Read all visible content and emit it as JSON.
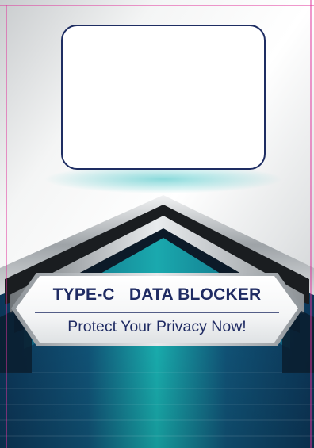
{
  "label": {
    "title": "TYPE-C   DATA BLOCKER",
    "tagline": "Protect Your Privacy Now!"
  },
  "colors": {
    "navy_text": "#1f2b63",
    "window_border": "#1e2d62",
    "teal": "#18a3ad",
    "deep_blue": "#0e3f66",
    "trim_pink": "#e0329a"
  },
  "decor": {
    "window": "blank-display-window",
    "chevron": "metallic-chevron-emblem"
  }
}
